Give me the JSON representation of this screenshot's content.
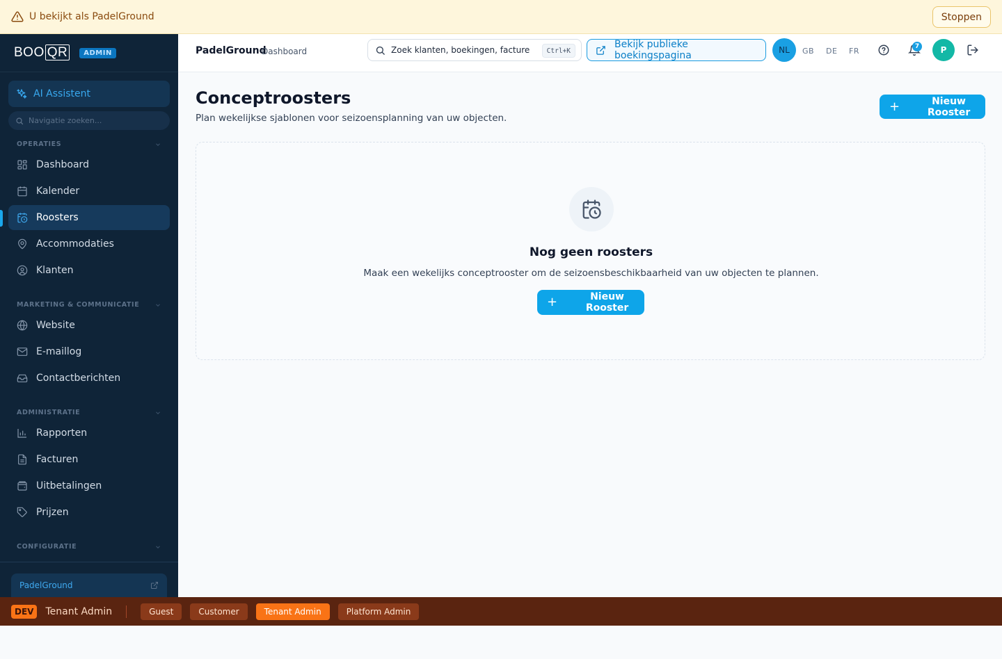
{
  "banner": {
    "text": "U bekijkt als PadelGround",
    "stop_label": "Stoppen"
  },
  "sidebar": {
    "logo_text": "BOO",
    "logo_qr": "QR",
    "admin_badge": "ADMIN",
    "ai_label": "AI Assistent",
    "search_placeholder": "Navigatie zoeken...",
    "sections": [
      {
        "label": "OPERATIES"
      },
      {
        "label": "MARKETING & COMMUNICATIE"
      },
      {
        "label": "ADMINISTRATIE"
      },
      {
        "label": "CONFIGURATIE"
      }
    ],
    "items": [
      {
        "label": "Dashboard",
        "icon": "layout-grid-icon"
      },
      {
        "label": "Kalender",
        "icon": "calendar-icon"
      },
      {
        "label": "Roosters",
        "icon": "calendar-clock-icon",
        "active": true
      },
      {
        "label": "Accommodaties",
        "icon": "map-pin-icon"
      },
      {
        "label": "Klanten",
        "icon": "user-circle-icon"
      },
      {
        "label": "Website",
        "icon": "globe-icon"
      },
      {
        "label": "E-maillog",
        "icon": "mail-icon"
      },
      {
        "label": "Contactberichten",
        "icon": "inbox-icon"
      },
      {
        "label": "Rapporten",
        "icon": "bar-chart-icon"
      },
      {
        "label": "Facturen",
        "icon": "file-text-icon"
      },
      {
        "label": "Uitbetalingen",
        "icon": "wallet-icon"
      },
      {
        "label": "Prijzen",
        "icon": "tag-icon"
      }
    ],
    "tenant_name": "PadelGround"
  },
  "topbar": {
    "title": "PadelGround",
    "subtitle": "Dashboard",
    "search_placeholder": "Zoek klanten, boekingen, facturen...",
    "shortcut": "Ctrl+K",
    "public_label": "Bekijk publieke boekingspagina",
    "languages": [
      "NL",
      "GB",
      "DE",
      "FR"
    ],
    "notification_count": "7",
    "avatar_initial": "P"
  },
  "main": {
    "title": "Conceptroosters",
    "subtitle": "Plan wekelijkse sjablonen voor seizoensplanning van uw objecten.",
    "new_button": "Nieuw Rooster",
    "empty_title": "Nog geen roosters",
    "empty_text": "Maak een wekelijks conceptrooster om de seizoensbeschikbaarheid van uw objecten te plannen.",
    "empty_button": "Nieuw Rooster"
  },
  "devbar": {
    "badge": "DEV",
    "current_role": "Tenant Admin",
    "roles": [
      {
        "label": "Guest"
      },
      {
        "label": "Customer"
      },
      {
        "label": "Tenant Admin",
        "active": true
      },
      {
        "label": "Platform Admin"
      }
    ]
  },
  "colors": {
    "accent": "#0ea5e9",
    "sidebar_bg": "#0f2438",
    "banner_bg": "#fef6dc",
    "devbar_bg": "#5a2410",
    "dev_orange": "#f97316"
  }
}
